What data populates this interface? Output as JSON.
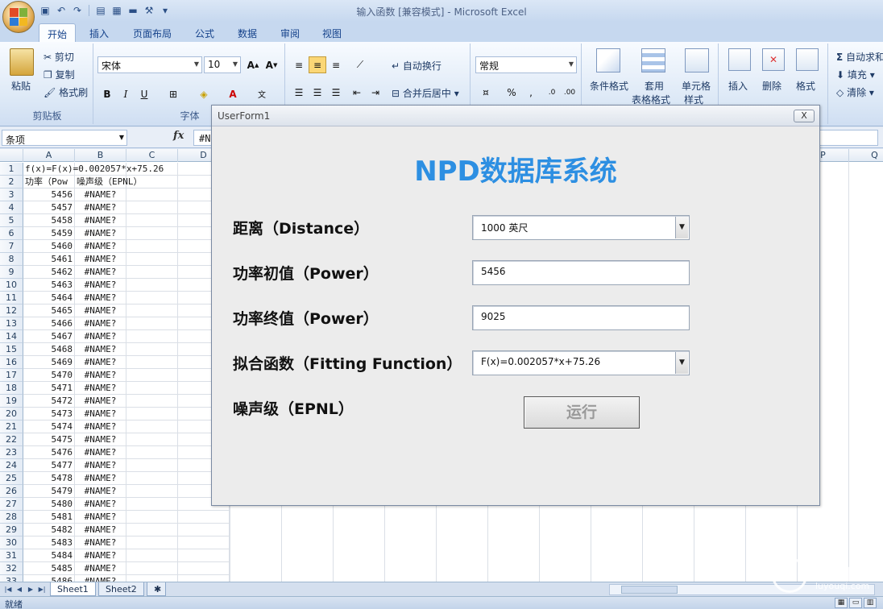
{
  "window": {
    "title": "输入函数  [兼容模式] - Microsoft Excel"
  },
  "ribbon": {
    "tabs": [
      "开始",
      "插入",
      "页面布局",
      "公式",
      "数据",
      "审阅",
      "视图"
    ],
    "clipboard": {
      "paste": "粘贴",
      "cut": "剪切",
      "copy": "复制",
      "format_painter": "格式刷",
      "label": "剪贴板"
    },
    "font": {
      "name": "宋体",
      "size": "10",
      "label": "字体"
    },
    "alignment": {
      "wrap": "自动换行",
      "merge": "合并后居中"
    },
    "number": {
      "format": "常规"
    },
    "styles": {
      "conditional": "条件格式",
      "table_1": "套用",
      "table_2": "表格格式",
      "cell_1": "单元格",
      "cell_2": "样式"
    },
    "cells": {
      "insert": "插入",
      "delete": "删除",
      "format": "格式"
    },
    "editing": {
      "autosum": "自动求和",
      "fill": "填充",
      "clear": "清除"
    }
  },
  "formula_bar": {
    "name_box": "条项",
    "fx": "fx",
    "content": "#N"
  },
  "sheet": {
    "columns": [
      "A",
      "B",
      "C",
      "D",
      "P",
      "Q"
    ],
    "row1_text": "f(x)=F(x)=0.002057*x+75.26",
    "row2_a": "功率（Pow",
    "row2_b": "噪声级（EPNL）",
    "error_value": "#NAME?",
    "rows": [
      {
        "n": "1"
      },
      {
        "n": "2"
      },
      {
        "n": "3",
        "a": "5456"
      },
      {
        "n": "4",
        "a": "5457"
      },
      {
        "n": "5",
        "a": "5458"
      },
      {
        "n": "6",
        "a": "5459"
      },
      {
        "n": "7",
        "a": "5460"
      },
      {
        "n": "8",
        "a": "5461"
      },
      {
        "n": "9",
        "a": "5462"
      },
      {
        "n": "10",
        "a": "5463"
      },
      {
        "n": "11",
        "a": "5464"
      },
      {
        "n": "12",
        "a": "5465"
      },
      {
        "n": "13",
        "a": "5466"
      },
      {
        "n": "14",
        "a": "5467"
      },
      {
        "n": "15",
        "a": "5468"
      },
      {
        "n": "16",
        "a": "5469"
      },
      {
        "n": "17",
        "a": "5470"
      },
      {
        "n": "18",
        "a": "5471"
      },
      {
        "n": "19",
        "a": "5472"
      },
      {
        "n": "20",
        "a": "5473"
      },
      {
        "n": "21",
        "a": "5474"
      },
      {
        "n": "22",
        "a": "5475"
      },
      {
        "n": "23",
        "a": "5476"
      },
      {
        "n": "24",
        "a": "5477"
      },
      {
        "n": "25",
        "a": "5478"
      },
      {
        "n": "26",
        "a": "5479"
      },
      {
        "n": "27",
        "a": "5480"
      },
      {
        "n": "28",
        "a": "5481"
      },
      {
        "n": "29",
        "a": "5482"
      },
      {
        "n": "30",
        "a": "5483"
      },
      {
        "n": "31",
        "a": "5484"
      },
      {
        "n": "32",
        "a": "5485"
      },
      {
        "n": "33",
        "a": "5486"
      }
    ]
  },
  "sheet_tabs": [
    "Sheet1",
    "Sheet2"
  ],
  "status": {
    "text": "就绪"
  },
  "userform": {
    "title": "UserForm1",
    "close": "X",
    "heading": "NPD数据库系统",
    "distance_label": "距离（Distance）",
    "distance_value": "1000 英尺",
    "power_start_label": "功率初值（Power）",
    "power_start_value": "5456",
    "power_end_label": "功率终值（Power）",
    "power_end_value": "9025",
    "fit_label": "拟合函数（Fitting Function）",
    "fit_value": "F(x)=0.002057*x+75.26",
    "noise_label": "噪声级（EPNL）",
    "run_button": "运行"
  },
  "watermark": {
    "text": "路由器",
    "url": "luyouqi.com"
  }
}
